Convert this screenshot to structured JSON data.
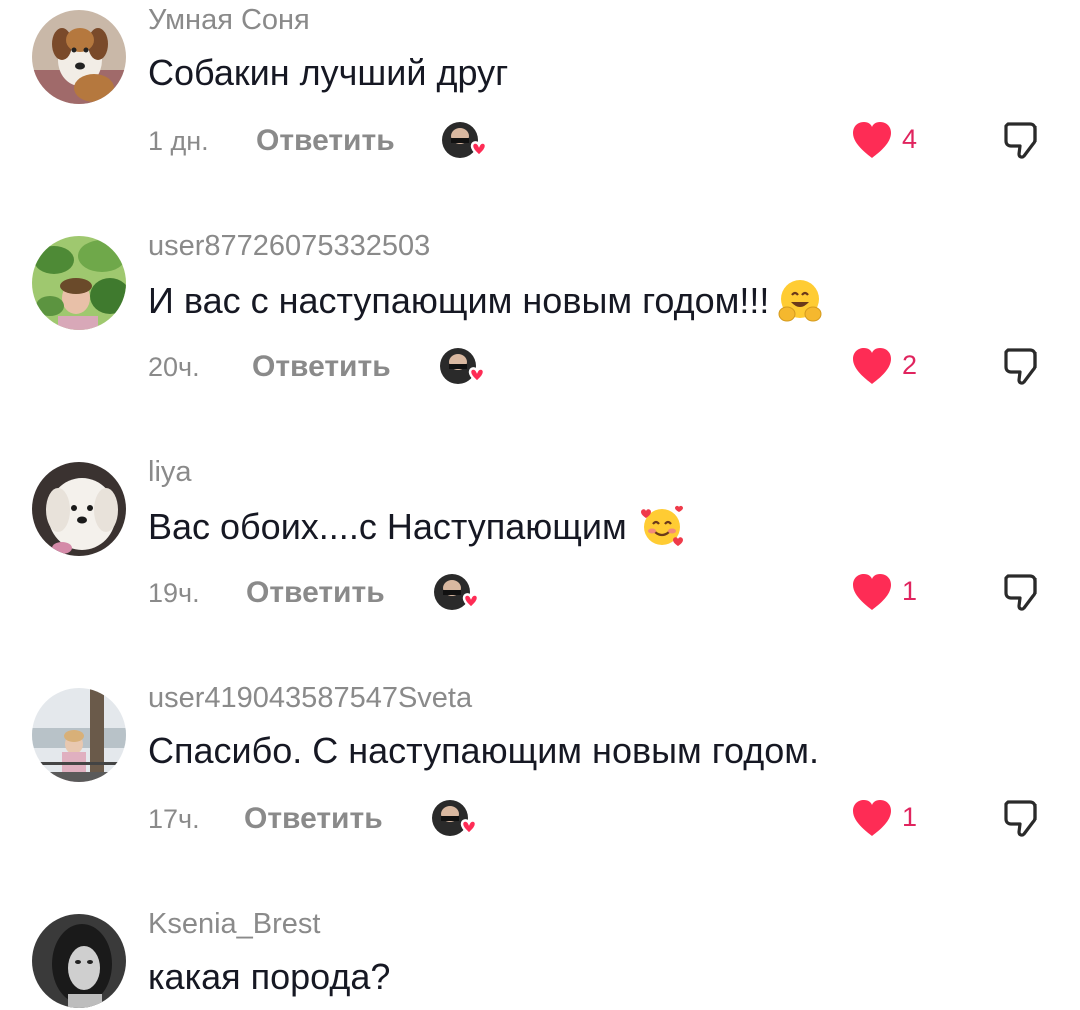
{
  "comments": [
    {
      "username": "Умная Соня",
      "text": "Собакин лучший друг",
      "emoji": "",
      "time": "1 дн.",
      "reply_label": "Ответить",
      "likes": "4",
      "avatar": "dog-avatar"
    },
    {
      "username": "user87726075332503",
      "text": "И вас с наступающим новым годом!!!",
      "emoji": "hugging-face-emoji",
      "time": "20ч.",
      "reply_label": "Ответить",
      "likes": "2",
      "avatar": "plants-avatar"
    },
    {
      "username": "liya",
      "text": "Вас обоих....с Наступающим",
      "emoji": "smiling-face-with-hearts-emoji",
      "time": "19ч.",
      "reply_label": "Ответить",
      "likes": "1",
      "avatar": "white-dog-avatar"
    },
    {
      "username": "user419043587547Sveta",
      "text": "Спасибо. С наступающим новым годом.",
      "emoji": "",
      "time": "17ч.",
      "reply_label": "Ответить",
      "likes": "1",
      "avatar": "person-seaside-avatar"
    },
    {
      "username": "Ksenia_Brest",
      "text": "какая порода?",
      "emoji": "",
      "avatar": "bw-portrait-avatar"
    }
  ],
  "colors": {
    "like_red": "#fe2c55",
    "muted_text": "#8a8a8a",
    "main_text": "#161823"
  }
}
